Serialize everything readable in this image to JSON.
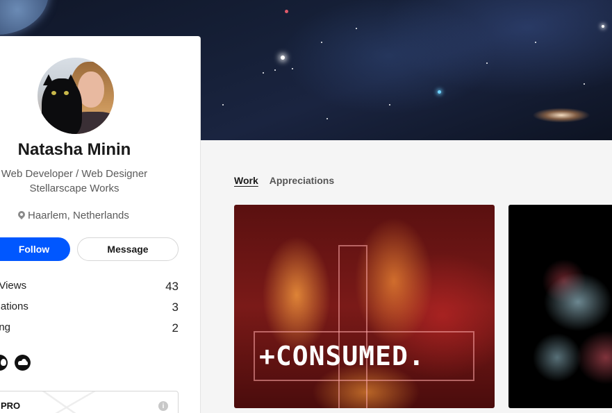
{
  "profile": {
    "name": "Natasha Minin",
    "occupation_line1": "Web Developer / Web Designer",
    "occupation_line2": "Stellarscape Works",
    "location": "Haarlem, Netherlands"
  },
  "actions": {
    "follow_label": "Follow",
    "message_label": "Message"
  },
  "stats": [
    {
      "label": "Project Views",
      "visible_label": "t Views",
      "value": "43"
    },
    {
      "label": "Appreciations",
      "visible_label": "ciations",
      "value": "3"
    },
    {
      "label": "Following",
      "visible_label": "ring",
      "value": "2"
    }
  ],
  "social_icons": [
    "github-icon",
    "soundcloud-icon"
  ],
  "pro_box": {
    "label": "PRO",
    "info_icon": "i"
  },
  "tabs": {
    "work": "Work",
    "appreciations": "Appreciations"
  },
  "projects": [
    {
      "title": "+CONSUMED."
    },
    {
      "title": ""
    }
  ],
  "colors": {
    "accent": "#0057ff",
    "page_bg": "#f5f5f5",
    "card_bg": "#ffffff"
  }
}
